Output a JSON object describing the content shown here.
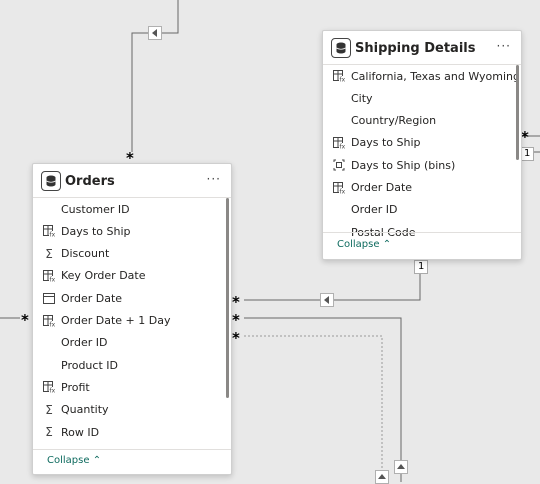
{
  "shipping_table": {
    "title": "Shipping Details",
    "more_label": "···",
    "collapse_label": "Collapse",
    "fields": [
      {
        "label": "California, Texas and Wyoming",
        "icon": "calculated-table-icon"
      },
      {
        "label": "City",
        "icon": "none"
      },
      {
        "label": "Country/Region",
        "icon": "none"
      },
      {
        "label": "Days to Ship",
        "icon": "calculated-column-icon"
      },
      {
        "label": "Days to Ship (bins)",
        "icon": "bins-icon"
      },
      {
        "label": "Order Date",
        "icon": "calculated-column-icon"
      },
      {
        "label": "Order ID",
        "icon": "none"
      },
      {
        "label": "Postal Code",
        "icon": "none"
      }
    ]
  },
  "orders_table": {
    "title": "Orders",
    "more_label": "···",
    "collapse_label": "Collapse",
    "fields": [
      {
        "label": "Customer ID",
        "icon": "none"
      },
      {
        "label": "Days to Ship",
        "icon": "calculated-column-icon"
      },
      {
        "label": "Discount",
        "icon": "sigma-icon"
      },
      {
        "label": "Key Order Date",
        "icon": "calculated-column-icon"
      },
      {
        "label": "Order Date",
        "icon": "calendar-icon"
      },
      {
        "label": "Order Date + 1 Day",
        "icon": "calculated-column-icon"
      },
      {
        "label": "Order ID",
        "icon": "none"
      },
      {
        "label": "Product ID",
        "icon": "none"
      },
      {
        "label": "Profit",
        "icon": "calculated-column-icon"
      },
      {
        "label": "Quantity",
        "icon": "sigma-icon"
      },
      {
        "label": "Row ID",
        "icon": "sigma-icon"
      }
    ]
  },
  "relationships": {
    "many": "*",
    "one": "1"
  }
}
